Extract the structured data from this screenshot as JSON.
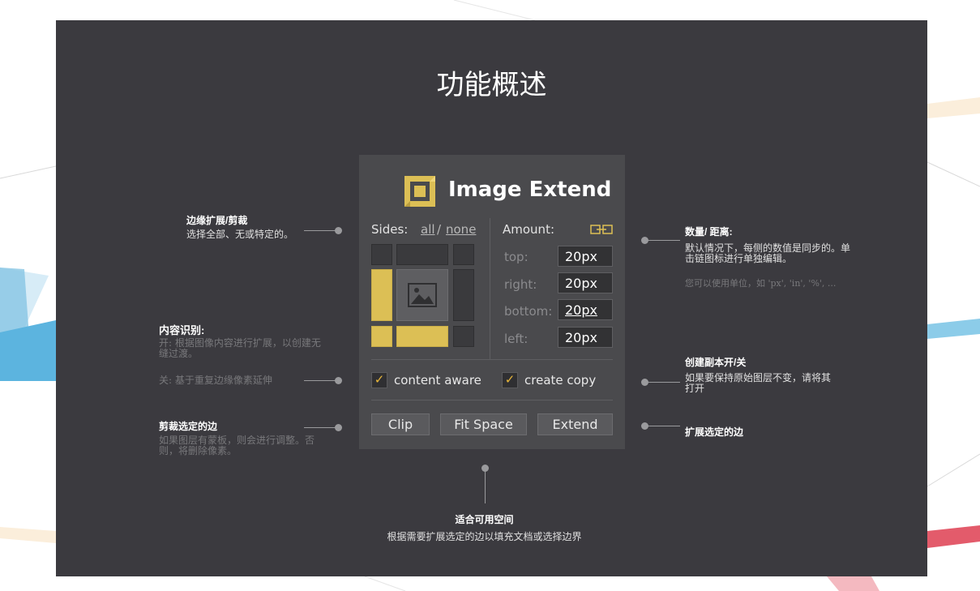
{
  "page": {
    "title": "功能概述"
  },
  "panel": {
    "logo_text": "Image Extend",
    "sides_label": "Sides:",
    "sides_all": "all",
    "sides_sep": "/",
    "sides_none": "none",
    "amount_label": "Amount:",
    "fields": [
      {
        "label": "top:",
        "value": "20px"
      },
      {
        "label": "right:",
        "value": "20px"
      },
      {
        "label": "bottom:",
        "value": "20px"
      },
      {
        "label": "left:",
        "value": "20px"
      }
    ],
    "content_aware": {
      "label": "content aware",
      "checked": true,
      "mark": "✓"
    },
    "create_copy": {
      "label": "create copy",
      "checked": true,
      "mark": "✓"
    },
    "buttons": {
      "clip": "Clip",
      "fit": "Fit Space",
      "extend": "Extend"
    },
    "accent_color": "#dcbf55"
  },
  "annotations": {
    "edge": {
      "title": "边缘扩展/剪裁",
      "desc": "选择全部、无或特定的。"
    },
    "content_aware": {
      "title": "内容识别:",
      "on": "开: 根据图像内容进行扩展，以创建无缝过渡。",
      "off": "关: 基于重复边缘像素延伸"
    },
    "clip": {
      "title": "剪裁选定的边",
      "desc": "如果图层有蒙板，则会进行调整。否则，将删除像素。"
    },
    "amount": {
      "title": "数量/ 距离:",
      "desc": "默认情况下，每侧的数值是同步的。单击链图标进行单独编辑。",
      "units": "您可以使用单位，如 'px', 'in', '%', ..."
    },
    "copy": {
      "title": "创建副本开/关",
      "desc": "如果要保持原始图层不变，请将其打开"
    },
    "extend": {
      "title": "扩展选定的边"
    },
    "fit": {
      "title": "适合可用空间",
      "desc": "根据需要扩展选定的边以填充文档或选择边界"
    }
  }
}
